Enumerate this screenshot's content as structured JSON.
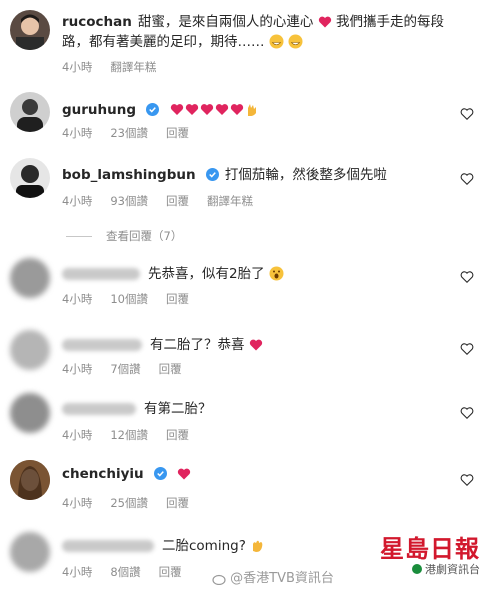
{
  "comments": [
    {
      "user": "rucochan",
      "text": "甜蜜，是來自兩個人的心連心",
      "text2": "我們攜手走的每段",
      "text3": "路，都有著美麗的足印，期待……",
      "time": "4小時",
      "action": "翻譯年糕"
    },
    {
      "user": "guruhung",
      "time": "4小時",
      "likes": "23個讚",
      "reply": "回覆"
    },
    {
      "user": "bob_lamshingbun",
      "text": "打個茄輪，然後整多個先啦",
      "time": "4小時",
      "likes": "93個讚",
      "reply": "回覆",
      "action": "翻譯年糕"
    },
    {
      "text": "先恭喜，似有2胎了",
      "time": "4小時",
      "likes": "10個讚",
      "reply": "回覆"
    },
    {
      "text": "有二胎了？恭喜",
      "time": "4小時",
      "likes": "7個讚",
      "reply": "回覆"
    },
    {
      "text": "有第二胎？",
      "time": "4小時",
      "likes": "12個讚",
      "reply": "回覆"
    },
    {
      "user": "chenchiyiu",
      "time": "4小時",
      "likes": "25個讚",
      "reply": "回覆"
    },
    {
      "text": "二胎coming?",
      "time": "4小時",
      "likes": "8個讚",
      "reply": "回覆"
    }
  ],
  "view_replies": "查看回覆（7）",
  "watermark": "@香港TVB資訊台",
  "logo_text": "星島日報",
  "logo_sub": "港劇資訊台",
  "colors": {
    "heart": "#e0245e",
    "verified": "#3897f0",
    "meta": "#8e8e8e"
  }
}
